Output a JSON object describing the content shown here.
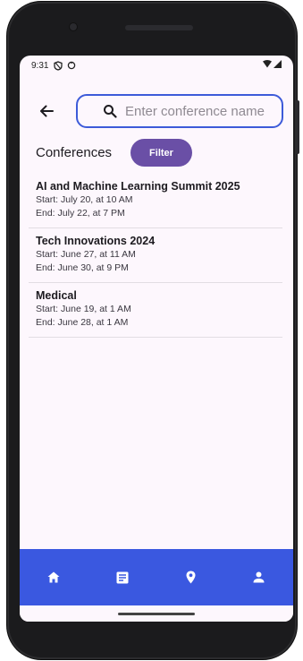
{
  "status_bar": {
    "time": "9:31",
    "left_icons": [
      "shield-icon",
      "sync-icon"
    ],
    "right_icons": [
      "wifi-icon",
      "signal-icon"
    ]
  },
  "search": {
    "placeholder": "Enter conference name",
    "value": ""
  },
  "header": {
    "title": "Conferences",
    "filter_label": "Filter"
  },
  "conferences": [
    {
      "name": "AI and Machine Learning Summit 2025",
      "start": "Start: July 20, at 10 AM",
      "end": "End: July 22, at 7 PM"
    },
    {
      "name": "Tech Innovations 2024",
      "start": "Start: June 27, at 11 AM",
      "end": "End: June 30, at 9 PM"
    },
    {
      "name": "Medical",
      "start": "Start: June 19, at 1 AM",
      "end": "End: June 28, at 1 AM"
    }
  ],
  "bottom_nav": {
    "items": [
      "home-icon",
      "article-icon",
      "location-pin-icon",
      "person-icon"
    ]
  },
  "colors": {
    "accent": "#3a58e0",
    "filter_button": "#6a4fa6",
    "search_border": "#3d5bd9",
    "background": "#fdf7fd"
  }
}
